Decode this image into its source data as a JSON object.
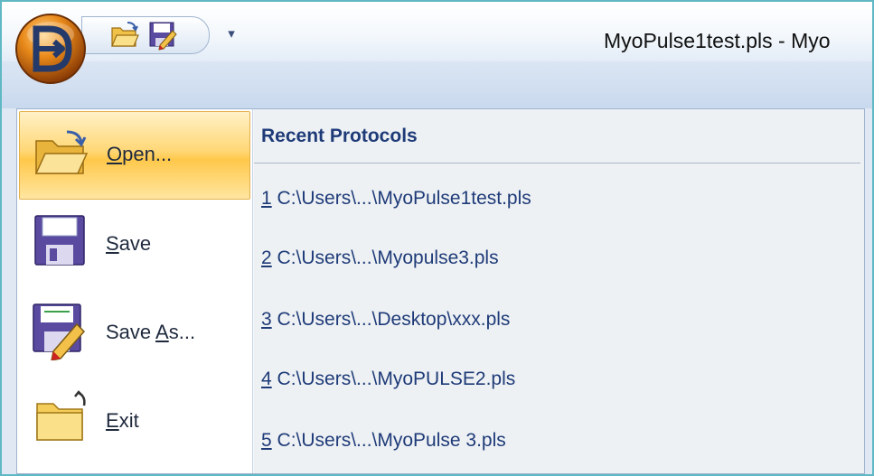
{
  "window": {
    "title": "MyoPulse1test.pls - Myo"
  },
  "quick_access_toolbar": {
    "icons": [
      "open-folder-icon",
      "save-as-icon"
    ],
    "dropdown_glyph": "▾"
  },
  "app_button": {
    "icon": "app-logo-icon",
    "letter": "D"
  },
  "menu": {
    "items": [
      {
        "mnemonic": "O",
        "rest": "pen...",
        "icon": "open-folder-icon",
        "active": true
      },
      {
        "mnemonic": "S",
        "rest": "ave",
        "icon": "save-disk-icon",
        "active": false
      },
      {
        "prefix": "Save ",
        "mnemonic": "A",
        "rest": "s...",
        "icon": "save-as-icon",
        "active": false
      },
      {
        "mnemonic": "E",
        "rest": "xit",
        "icon": "exit-folder-icon",
        "active": false
      }
    ]
  },
  "recent": {
    "title": "Recent Protocols",
    "items": [
      {
        "num": "1",
        "path": " C:\\Users\\...\\MyoPulse1test.pls"
      },
      {
        "num": "2",
        "path": " C:\\Users\\...\\Myopulse3.pls"
      },
      {
        "num": "3",
        "path": " C:\\Users\\...\\Desktop\\xxx.pls"
      },
      {
        "num": "4",
        "path": " C:\\Users\\...\\MyoPULSE2.pls"
      },
      {
        "num": "5",
        "path": " C:\\Users\\...\\MyoPulse 3.pls"
      }
    ]
  },
  "colors": {
    "frame_border": "#5fb8c4",
    "active_item": "#ffd776",
    "recent_text": "#1e3b78"
  }
}
